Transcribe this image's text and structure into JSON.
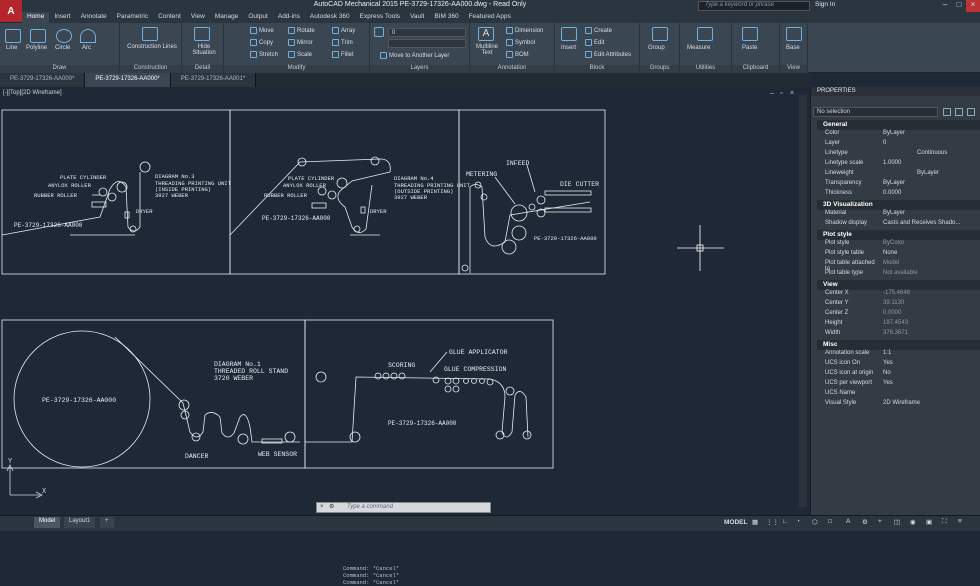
{
  "title_bar": {
    "app_letter": "A",
    "title": "AutoCAD Mechanical 2015   PE-3729-17326-AA000.dwg - Read Only",
    "search_placeholder": "Type a keyword or phrase",
    "sign_in": "Sign In"
  },
  "menu_tabs": [
    "Home",
    "Insert",
    "Annotate",
    "Parametric",
    "Content",
    "View",
    "Manage",
    "Output",
    "Add-ins",
    "Autodesk 360",
    "Express Tools",
    "Vault",
    "BIM 360",
    "Featured Apps"
  ],
  "ribbon": {
    "draw": {
      "title": "Draw",
      "line": "Line",
      "polyline": "Polyline",
      "circle": "Circle",
      "arc": "Arc"
    },
    "construction": {
      "title": "Construction",
      "label": "Construction Lines"
    },
    "detail": {
      "title": "Detail",
      "label": "Hide Situation"
    },
    "modify": {
      "title": "Modify",
      "move": "Move",
      "rotate": "Rotate",
      "array": "Array",
      "copy": "Copy",
      "mirror": "Mirror",
      "trim": "Trim",
      "stretch": "Stretch",
      "scale": "Scale",
      "fillet": "Fillet"
    },
    "layers": {
      "title": "Layers",
      "layer_value": "0",
      "move_to_layer": "Move to Another Layer"
    },
    "annotation": {
      "title": "Annotation",
      "multiline_text": "Multiline Text",
      "dimension": "Dimension",
      "symbol": "Symbol",
      "bom": "BOM"
    },
    "block": {
      "title": "Block",
      "insert": "Insert",
      "create": "Create",
      "edit": "Edit",
      "edit_attributes": "Edit Attributes"
    },
    "groups": {
      "title": "Groups",
      "group": "Group"
    },
    "utilities": {
      "title": "Utilities",
      "measure": "Measure"
    },
    "clipboard": {
      "title": "Clipboard",
      "paste": "Paste"
    },
    "view": {
      "title": "View",
      "base": "Base"
    }
  },
  "doc_tabs": [
    "PE-3729-17326-AA000*",
    "PE-3729-17326-AA000*",
    "PE-3729-17326-AA001*"
  ],
  "viewport_label": "[-][Top][2D Wireframe]",
  "drawing": {
    "d3": {
      "title": "DIAGRAM No.3",
      "sub1": "THREADING PRINTING UNIT",
      "sub2": "(INSIDE PRINTING)",
      "sub3": "3927 WEBER",
      "plate": "PLATE CYLINDER",
      "anilox": "ANYLOX ROLLER",
      "rubber": "RUBBER ROLLER",
      "dryer": "DRYER",
      "part": "PE-3729-17326-AA000"
    },
    "d4": {
      "title": "DIAGRAM No.4",
      "sub1": "THREADING PRINTING UNIT",
      "sub2": "(OUTSIDE PRINTING)",
      "sub3": "3927 WEBER",
      "plate": "PLATE CYLINDER",
      "anilox": "ANYLOX ROLLER",
      "rubber": "RUBBER ROLLER",
      "dryer": "DRYER",
      "part": "PE-3729-17326-AA000"
    },
    "d5": {
      "metering": "METERING",
      "infeed": "INFEED",
      "cutter": "DIE CUTTER",
      "part": "PE-3729-17326-AA000"
    },
    "d1": {
      "title": "DIAGRAM No.1",
      "sub1": "THREADED ROLL STAND",
      "sub2": "3720 WEBER",
      "part": "PE-3729-17326-AA000",
      "dancer": "DANCER",
      "web_sensor": "WEB SENSOR"
    },
    "d2": {
      "scoring": "SCORING",
      "glue_app": "GLUE APPLICATOR",
      "glue_comp": "GLUE COMPRESSION",
      "part": "PE-3729-17326-AA000"
    }
  },
  "command_history": [
    "Command: *Cancel*",
    "Command: *Cancel*",
    "Command: *Cancel*"
  ],
  "command_placeholder": "Type a command",
  "properties": {
    "header": "PROPERTIES",
    "selection": "No selection",
    "sections": {
      "general": "General",
      "viz": "3D Visualization",
      "plot": "Plot style",
      "view": "View",
      "misc": "Misc"
    },
    "general": [
      [
        "Color",
        "ByLayer"
      ],
      [
        "Layer",
        "0"
      ],
      [
        "Linetype",
        "Continuous"
      ],
      [
        "Linetype scale",
        "1.0000"
      ],
      [
        "Lineweight",
        "ByLayer"
      ],
      [
        "Transparency",
        "ByLayer"
      ],
      [
        "Thickness",
        "0.0000"
      ]
    ],
    "viz": [
      [
        "Material",
        "ByLayer"
      ],
      [
        "Shadow display",
        "Casts and Receives Shado..."
      ]
    ],
    "plot": [
      [
        "Plot style",
        "ByColor"
      ],
      [
        "Plot style table",
        "None"
      ],
      [
        "Plot table attached to",
        "Model"
      ],
      [
        "Plot table type",
        "Not available"
      ]
    ],
    "view": [
      [
        "Center X",
        "-175.4648"
      ],
      [
        "Center Y",
        "39.1130"
      ],
      [
        "Center Z",
        "0.0000"
      ],
      [
        "Height",
        "197.4543"
      ],
      [
        "Width",
        "376.3671"
      ]
    ],
    "misc": [
      [
        "Annotation scale",
        "1:1"
      ],
      [
        "UCS icon On",
        "Yes"
      ],
      [
        "UCS icon at origin",
        "No"
      ],
      [
        "UCS per viewport",
        "Yes"
      ],
      [
        "UCS Name",
        ""
      ],
      [
        "Visual Style",
        "2D Wireframe"
      ]
    ]
  },
  "status_bar": {
    "model_tab": "Model",
    "layout_tab": "Layout1",
    "add_tab": "+",
    "model_indicator": "MODEL",
    "ucs_y": "Y",
    "ucs_x": "X"
  }
}
